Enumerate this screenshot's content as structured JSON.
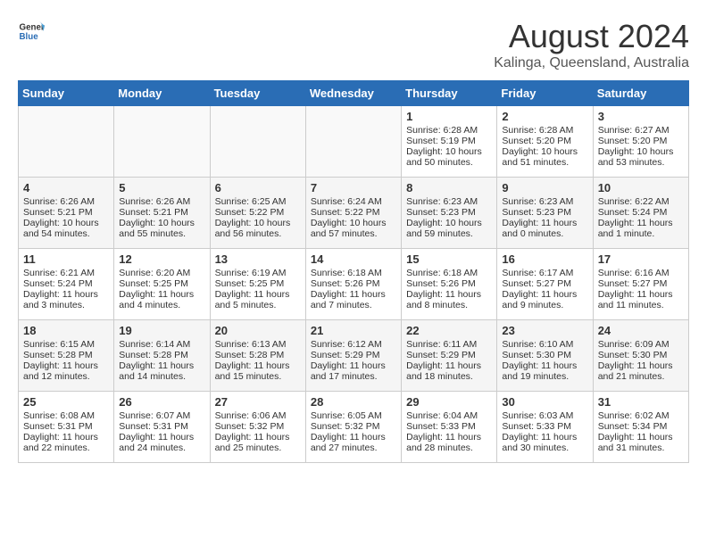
{
  "header": {
    "logo_general": "General",
    "logo_blue": "Blue",
    "title": "August 2024",
    "subtitle": "Kalinga, Queensland, Australia"
  },
  "calendar": {
    "days_of_week": [
      "Sunday",
      "Monday",
      "Tuesday",
      "Wednesday",
      "Thursday",
      "Friday",
      "Saturday"
    ],
    "weeks": [
      [
        {
          "day": "",
          "content": ""
        },
        {
          "day": "",
          "content": ""
        },
        {
          "day": "",
          "content": ""
        },
        {
          "day": "",
          "content": ""
        },
        {
          "day": "1",
          "content": "Sunrise: 6:28 AM\nSunset: 5:19 PM\nDaylight: 10 hours\nand 50 minutes."
        },
        {
          "day": "2",
          "content": "Sunrise: 6:28 AM\nSunset: 5:20 PM\nDaylight: 10 hours\nand 51 minutes."
        },
        {
          "day": "3",
          "content": "Sunrise: 6:27 AM\nSunset: 5:20 PM\nDaylight: 10 hours\nand 53 minutes."
        }
      ],
      [
        {
          "day": "4",
          "content": "Sunrise: 6:26 AM\nSunset: 5:21 PM\nDaylight: 10 hours\nand 54 minutes."
        },
        {
          "day": "5",
          "content": "Sunrise: 6:26 AM\nSunset: 5:21 PM\nDaylight: 10 hours\nand 55 minutes."
        },
        {
          "day": "6",
          "content": "Sunrise: 6:25 AM\nSunset: 5:22 PM\nDaylight: 10 hours\nand 56 minutes."
        },
        {
          "day": "7",
          "content": "Sunrise: 6:24 AM\nSunset: 5:22 PM\nDaylight: 10 hours\nand 57 minutes."
        },
        {
          "day": "8",
          "content": "Sunrise: 6:23 AM\nSunset: 5:23 PM\nDaylight: 10 hours\nand 59 minutes."
        },
        {
          "day": "9",
          "content": "Sunrise: 6:23 AM\nSunset: 5:23 PM\nDaylight: 11 hours\nand 0 minutes."
        },
        {
          "day": "10",
          "content": "Sunrise: 6:22 AM\nSunset: 5:24 PM\nDaylight: 11 hours\nand 1 minute."
        }
      ],
      [
        {
          "day": "11",
          "content": "Sunrise: 6:21 AM\nSunset: 5:24 PM\nDaylight: 11 hours\nand 3 minutes."
        },
        {
          "day": "12",
          "content": "Sunrise: 6:20 AM\nSunset: 5:25 PM\nDaylight: 11 hours\nand 4 minutes."
        },
        {
          "day": "13",
          "content": "Sunrise: 6:19 AM\nSunset: 5:25 PM\nDaylight: 11 hours\nand 5 minutes."
        },
        {
          "day": "14",
          "content": "Sunrise: 6:18 AM\nSunset: 5:26 PM\nDaylight: 11 hours\nand 7 minutes."
        },
        {
          "day": "15",
          "content": "Sunrise: 6:18 AM\nSunset: 5:26 PM\nDaylight: 11 hours\nand 8 minutes."
        },
        {
          "day": "16",
          "content": "Sunrise: 6:17 AM\nSunset: 5:27 PM\nDaylight: 11 hours\nand 9 minutes."
        },
        {
          "day": "17",
          "content": "Sunrise: 6:16 AM\nSunset: 5:27 PM\nDaylight: 11 hours\nand 11 minutes."
        }
      ],
      [
        {
          "day": "18",
          "content": "Sunrise: 6:15 AM\nSunset: 5:28 PM\nDaylight: 11 hours\nand 12 minutes."
        },
        {
          "day": "19",
          "content": "Sunrise: 6:14 AM\nSunset: 5:28 PM\nDaylight: 11 hours\nand 14 minutes."
        },
        {
          "day": "20",
          "content": "Sunrise: 6:13 AM\nSunset: 5:28 PM\nDaylight: 11 hours\nand 15 minutes."
        },
        {
          "day": "21",
          "content": "Sunrise: 6:12 AM\nSunset: 5:29 PM\nDaylight: 11 hours\nand 17 minutes."
        },
        {
          "day": "22",
          "content": "Sunrise: 6:11 AM\nSunset: 5:29 PM\nDaylight: 11 hours\nand 18 minutes."
        },
        {
          "day": "23",
          "content": "Sunrise: 6:10 AM\nSunset: 5:30 PM\nDaylight: 11 hours\nand 19 minutes."
        },
        {
          "day": "24",
          "content": "Sunrise: 6:09 AM\nSunset: 5:30 PM\nDaylight: 11 hours\nand 21 minutes."
        }
      ],
      [
        {
          "day": "25",
          "content": "Sunrise: 6:08 AM\nSunset: 5:31 PM\nDaylight: 11 hours\nand 22 minutes."
        },
        {
          "day": "26",
          "content": "Sunrise: 6:07 AM\nSunset: 5:31 PM\nDaylight: 11 hours\nand 24 minutes."
        },
        {
          "day": "27",
          "content": "Sunrise: 6:06 AM\nSunset: 5:32 PM\nDaylight: 11 hours\nand 25 minutes."
        },
        {
          "day": "28",
          "content": "Sunrise: 6:05 AM\nSunset: 5:32 PM\nDaylight: 11 hours\nand 27 minutes."
        },
        {
          "day": "29",
          "content": "Sunrise: 6:04 AM\nSunset: 5:33 PM\nDaylight: 11 hours\nand 28 minutes."
        },
        {
          "day": "30",
          "content": "Sunrise: 6:03 AM\nSunset: 5:33 PM\nDaylight: 11 hours\nand 30 minutes."
        },
        {
          "day": "31",
          "content": "Sunrise: 6:02 AM\nSunset: 5:34 PM\nDaylight: 11 hours\nand 31 minutes."
        }
      ]
    ]
  }
}
